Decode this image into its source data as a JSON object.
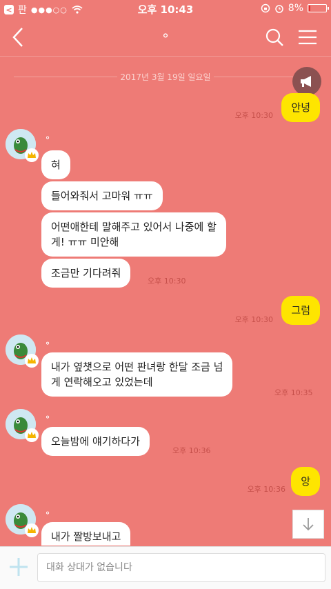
{
  "status_bar": {
    "back_app": "판",
    "carrier_dots": "●●●○○",
    "time": "오후 10:43",
    "battery": "8%",
    "battery_level": 0.08
  },
  "header": {
    "title": "⚬"
  },
  "chat": {
    "date": "2017년 3월 19일 일요일",
    "messages": [
      {
        "text": "안녕",
        "time": "오후 10:30"
      },
      {
        "text": "혀"
      },
      {
        "text": "들어와줘서 고마워 ㅠㅠ"
      },
      {
        "text_line1": "어떤애한테 말해주고 있어서 나중에 할",
        "text_line2": "게! ㅠㅠ 미안해"
      },
      {
        "text": "조금만 기다려줘",
        "time": "오후 10:30"
      },
      {
        "text": "그럼",
        "time": "오후 10:30"
      },
      {
        "text_line1": "내가 옆챗으로 어떤 판녀랑 한달 조금 넘",
        "text_line2": "게 연락해오고 있었는데",
        "time": "오후 10:35"
      },
      {
        "text": "오늘밤에 얘기하다가",
        "time": "오후 10:36"
      },
      {
        "text": "앙",
        "time": "오후 10:36"
      },
      {
        "text": "내가 짤방보내고"
      }
    ],
    "sender_name": "⚬"
  },
  "input": {
    "placeholder": "대화 상대가 없습니다"
  },
  "colors": {
    "background": "#ee7b76",
    "my_bubble": "#fee500",
    "their_bubble": "#ffffff"
  }
}
